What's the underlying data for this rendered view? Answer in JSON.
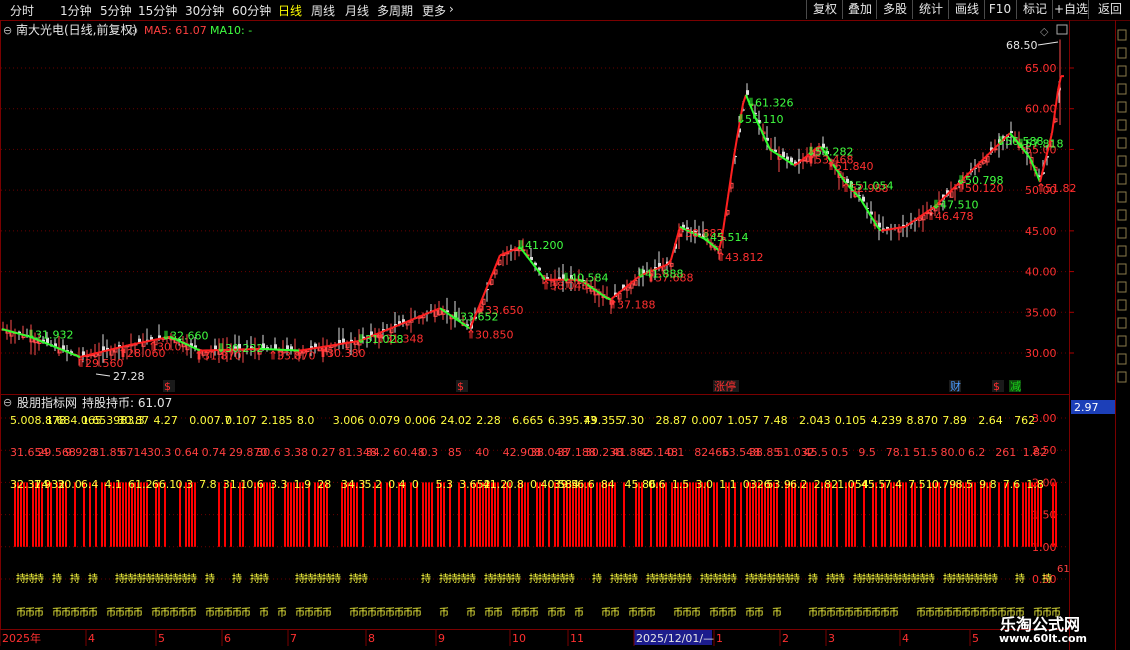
{
  "toolbar": {
    "periods": [
      "分时",
      "1分钟",
      "5分钟",
      "15分钟",
      "30分钟",
      "60分钟",
      "日线",
      "周线",
      "月线",
      "多周期",
      "更多"
    ],
    "active_period": "日线",
    "right_buttons": [
      "复权",
      "叠加",
      "多股",
      "统计",
      "画线",
      "F10",
      "+自选",
      "返回"
    ],
    "annotate_button": "标记"
  },
  "main_chart": {
    "stock_title": "南大光电(日线,前复权)",
    "ma5_label": "MA5: 61.07",
    "ma10_label": "MA10: -",
    "high_label": "68.50",
    "low_label": "27.28",
    "price_axis": [
      "65.00",
      "60.00",
      "55.00",
      "50.00",
      "45.00",
      "40.00",
      "35.00",
      "30.00"
    ],
    "buy_points": [
      "29.560",
      "28.060",
      "30.0",
      "31.870",
      "33.870",
      "30.380",
      "31.348",
      "30.850",
      "33.650",
      "38.048",
      "37.188",
      "37.688",
      "38.882",
      "43.812",
      "53.468",
      "51.840",
      "52.988",
      "46.478",
      "50.120",
      "51.82"
    ],
    "sell_points": [
      "31.932",
      "32.660",
      "30.232",
      "31.028",
      "33.652",
      "41.200",
      "40.584",
      "41.888",
      "45.514",
      "61.326",
      "55.110",
      "53.282",
      "51.054",
      "47.510",
      "50.798",
      "56.588",
      "57.818"
    ],
    "event_markers": [
      {
        "text": "$",
        "color": "#ff3030"
      },
      {
        "text": "$",
        "color": "#ff3030"
      },
      {
        "text": "涨停",
        "color": "#ff3030"
      },
      {
        "text": "财",
        "color": "#4a9cff"
      },
      {
        "text": "$",
        "color": "#ff3030"
      },
      {
        "text": "减",
        "color": "#19d219"
      }
    ]
  },
  "indicator": {
    "title": "股朋指标网",
    "holding_label": "持股持币: 61.07",
    "axis_labels": [
      "3.00",
      "2.50",
      "2.00",
      "1.50",
      "1.00",
      "0.50"
    ],
    "current_value": "2.97",
    "side_value": "61",
    "hold_char": "持",
    "coin_char": "币",
    "row_yellow_1": [
      "5.008.878",
      "1.684.065",
      "1.653983.3",
      "30.87",
      "4.27",
      "0.007.7",
      "0.107",
      "2.185",
      "8.0",
      "3.006",
      "0.079",
      "0.006",
      "24.02",
      "2.28",
      "6.665",
      "6.395.73",
      "49.355",
      "7.30",
      "28.87",
      "0.007",
      "1.057",
      "7.48",
      "2.043",
      "0.105",
      "4.239",
      "8.870",
      "7.89",
      "2.64",
      "762"
    ],
    "row_red": [
      "31.654",
      "29.568",
      "9.928",
      "31.85",
      "6714",
      "30.3",
      "0.64",
      "0.74",
      "29.870",
      "30.6",
      "3.38",
      "0.27",
      "81.348",
      "34.2",
      "60.48",
      "0.3",
      "85",
      "40",
      "42.908",
      "38.048",
      "37.188",
      "30.238",
      "41.882",
      "45.148",
      "0.1",
      "82466",
      "53.548",
      "38.85",
      "51.032",
      "45.5",
      "0.5",
      "9.5",
      "78.1",
      "51.5",
      "80.0",
      "6.2",
      "261",
      "1.82"
    ],
    "row_yellow_2": [
      "32.374",
      "1.932",
      "30.0",
      "6.4",
      "4.1",
      "61.2",
      "66.1",
      "0.3",
      "7.8",
      "31.1",
      "0.6",
      "3.3",
      "1.9",
      "28",
      "34.3",
      "5.2",
      "0.4",
      "0",
      "5.3",
      "3.652",
      "41.2",
      "0.8",
      "0.40.584",
      "39.5",
      "6.6",
      "84",
      "45.86",
      "0.6",
      "1.5",
      "3.0",
      "1.1",
      "0326",
      "53.9",
      "6.2",
      "2.82",
      "1.054",
      "45.5",
      "7.4",
      "7.51",
      "0.79",
      "8.5",
      "9.8",
      "7.6",
      "1.8"
    ]
  },
  "date_axis": {
    "labels": [
      "2025年",
      "4",
      "5",
      "6",
      "7",
      "8",
      "9",
      "10",
      "11",
      "2025/12/01/—",
      "1",
      "2",
      "3",
      "4",
      "5"
    ]
  },
  "watermark": {
    "text_cn": "乐淘公式网",
    "url": "www.60lt.com"
  }
}
